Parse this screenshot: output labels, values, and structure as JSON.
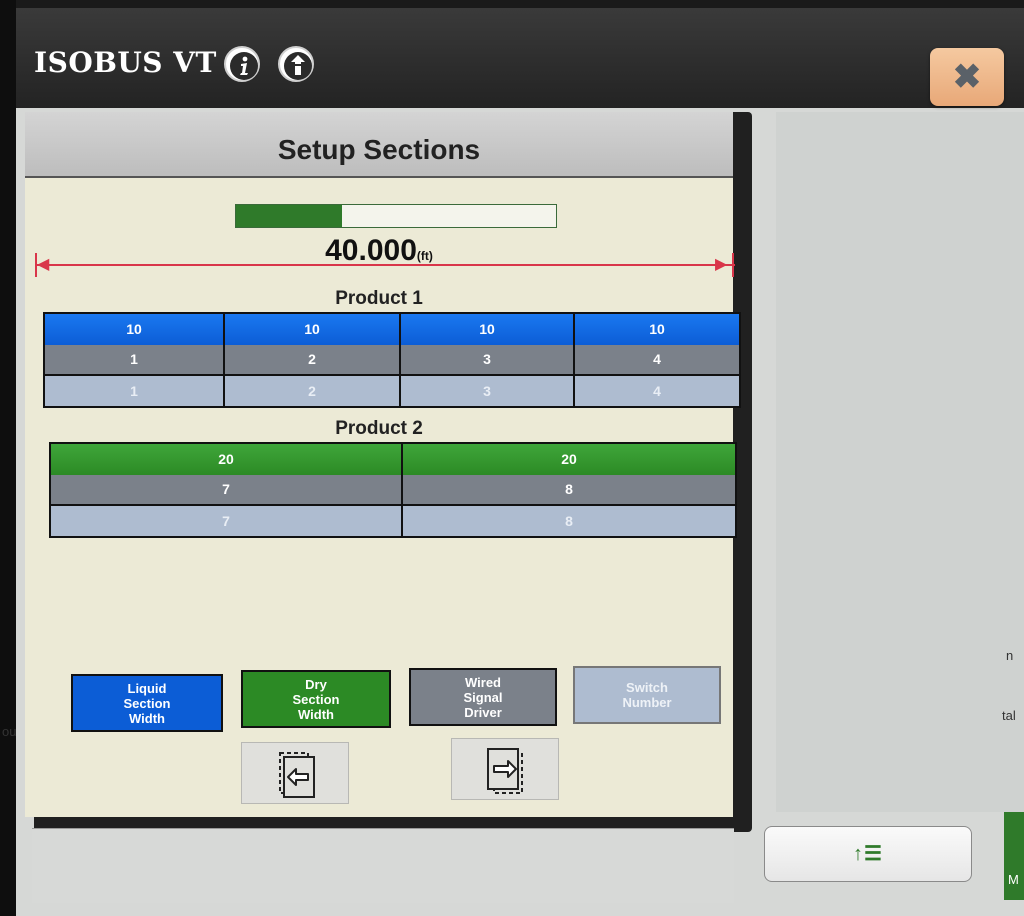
{
  "window": {
    "title": "ISOBUS VT",
    "close_label": "✖"
  },
  "titlebar_icons": [
    {
      "name": "info-icon"
    },
    {
      "name": "upload-info-icon"
    }
  ],
  "page": {
    "title": "Setup Sections",
    "progress_fraction": 0.33,
    "width_value": "40.000",
    "width_unit": "(ft)"
  },
  "product1": {
    "label": "Product 1",
    "rows": [
      [
        "10",
        "10",
        "10",
        "10"
      ],
      [
        "1",
        "2",
        "3",
        "4"
      ],
      [
        "1",
        "2",
        "3",
        "4"
      ]
    ]
  },
  "product2": {
    "label": "Product 2",
    "rows": [
      [
        "20",
        "20"
      ],
      [
        "7",
        "8"
      ],
      [
        "7",
        "8"
      ]
    ]
  },
  "legend": [
    {
      "lines": [
        "Liquid",
        "Section",
        "Width"
      ],
      "color": "#0c5dd6"
    },
    {
      "lines": [
        "Dry",
        "Section",
        "Width"
      ],
      "color": "#2c8a25"
    },
    {
      "lines": [
        "Wired",
        "Signal",
        "Driver"
      ],
      "color": "#7b818a"
    },
    {
      "lines": [
        "Switch",
        "Number"
      ],
      "color": "#aebcd0"
    }
  ],
  "nav_buttons": [
    {
      "name": "move-left-icon"
    },
    {
      "name": "move-right-icon"
    }
  ],
  "page_button_label": "↑☰",
  "edge_text": {
    "right1": "n",
    "right2": "tal",
    "left1": "ou",
    "bottom": "M"
  }
}
